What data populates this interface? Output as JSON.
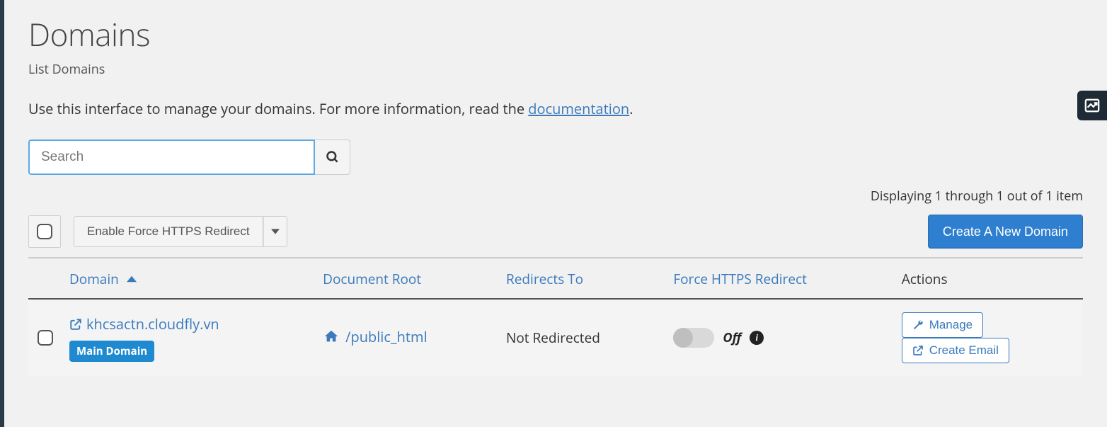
{
  "header": {
    "title": "Domains",
    "subtitle": "List Domains",
    "intro_prefix": "Use this interface to manage your domains. For more information, read the ",
    "intro_link": "documentation",
    "intro_suffix": "."
  },
  "search": {
    "placeholder": "Search"
  },
  "paging": {
    "text": "Displaying 1 through 1 out of 1 item"
  },
  "toolbar": {
    "enable_https_label": "Enable Force HTTPS Redirect",
    "create_label": "Create A New Domain"
  },
  "columns": {
    "domain": "Domain",
    "doc_root": "Document Root",
    "redirects_to": "Redirects To",
    "force_https": "Force HTTPS Redirect",
    "actions": "Actions"
  },
  "row": {
    "domain": "khcsactn.cloudfly.vn",
    "badge": "Main Domain",
    "doc_root": "/public_html",
    "redirects_to": "Not Redirected",
    "https_state": "Off",
    "manage_label": "Manage",
    "create_email_label": "Create Email"
  }
}
